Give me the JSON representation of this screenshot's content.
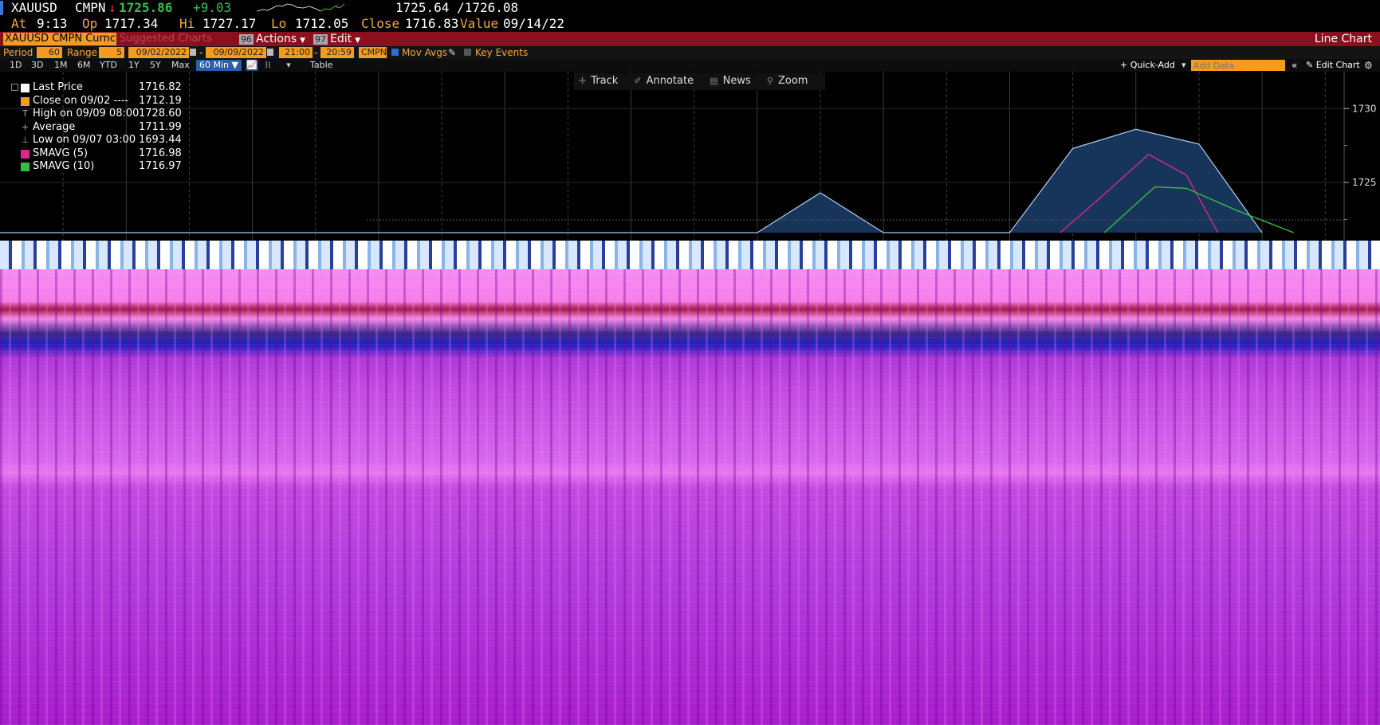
{
  "quote": {
    "ticker": "XAUUSD",
    "source": "CMPN",
    "direction_arrow": "↓",
    "last": "1725.86",
    "change": "+9.03",
    "bid_ask": "1725.64 /1726.08",
    "at_label": "At",
    "time": "9:13",
    "open_label": "Op",
    "open": "1717.34",
    "high_label": "Hi",
    "high": "1727.17",
    "low_label": "Lo",
    "low": "1712.05",
    "close_label": "Close",
    "close": "1716.83",
    "value_label": "Value",
    "value_date": "09/14/22"
  },
  "command_bar": {
    "security_value": "XAUUSD CMPN Curncy",
    "suggested_label": "Suggested Charts",
    "actions_num": "96",
    "actions_label": "Actions",
    "edit_num": "97",
    "edit_label": "Edit",
    "view_title": "Line Chart"
  },
  "params": {
    "period_label": "Period",
    "period_value": "60",
    "range_label": "Range",
    "range_value": "5",
    "start_date": "09/02/2022",
    "end_date": "09/09/2022",
    "dash": "-",
    "start_time": "21:00",
    "end_time": "20:59",
    "source": "CMPN",
    "mov_avgs_label": "Mov Avgs",
    "key_events_label": "Key Events"
  },
  "ranges": {
    "items": [
      "1D",
      "3D",
      "1M",
      "6M",
      "YTD",
      "1Y",
      "5Y",
      "Max"
    ],
    "interval": "60 Min",
    "table_label": "Table",
    "quick_add_label": "+ Quick-Add",
    "add_data_placeholder": "Add Data",
    "edit_chart_label": "Edit Chart"
  },
  "chart_tools": {
    "track": "Track",
    "annotate": "Annotate",
    "news": "News",
    "zoom": "Zoom"
  },
  "legend": [
    {
      "name": "Last Price",
      "value": "1716.82",
      "marker": "swatch",
      "color": "#ffffff"
    },
    {
      "name": "Close on 09/02 ----",
      "value": "1712.19",
      "marker": "swatch",
      "color": "#f39c1f"
    },
    {
      "name": "High on 09/09 08:00",
      "value": "1728.60",
      "marker": "T",
      "color": "#aaaaaa"
    },
    {
      "name": "Average",
      "value": "1711.99",
      "marker": "+",
      "color": "#aaaaaa"
    },
    {
      "name": "Low on 09/07 03:00",
      "value": "1693.44",
      "marker": "⊥",
      "color": "#aaaaaa"
    },
    {
      "name": "SMAVG (5)",
      "value": "1716.98",
      "marker": "swatch",
      "color": "#d92a8a"
    },
    {
      "name": "SMAVG (10)",
      "value": "1716.97",
      "marker": "swatch",
      "color": "#2fbf46"
    }
  ],
  "chart_data": {
    "type": "line",
    "y_ticks": [
      "1730",
      "1725"
    ],
    "ylim": [
      1721.6,
      1732.5
    ],
    "grid": true,
    "legend_position": "top-left",
    "series": [
      {
        "name": "Last Price",
        "color": "#a9c5e8",
        "fill": "#17345a",
        "x": [
          0,
          1,
          2,
          3,
          4,
          5,
          6,
          7,
          8,
          9,
          10,
          11,
          12,
          13,
          14,
          15,
          16,
          17,
          18,
          19,
          20
        ],
        "y": [
          1721.6,
          1721.6,
          1721.6,
          1721.6,
          1721.6,
          1721.6,
          1721.6,
          1721.6,
          1721.6,
          1721.6,
          1721.6,
          1721.6,
          1721.6,
          1724.3,
          1721.6,
          1721.6,
          1721.6,
          1727.3,
          1728.6,
          1727.6,
          1721.6
        ]
      },
      {
        "name": "SMAVG (5)",
        "color": "#d92a8a",
        "x": [
          16.8,
          17.5,
          18.2,
          18.8,
          19.3
        ],
        "y": [
          1721.6,
          1724.2,
          1726.9,
          1725.5,
          1721.6
        ]
      },
      {
        "name": "SMAVG (10)",
        "color": "#2fbf46",
        "x": [
          17.5,
          18.3,
          18.8,
          19.6,
          20.5
        ],
        "y": [
          1721.6,
          1724.7,
          1724.6,
          1723.1,
          1721.6
        ]
      }
    ]
  }
}
